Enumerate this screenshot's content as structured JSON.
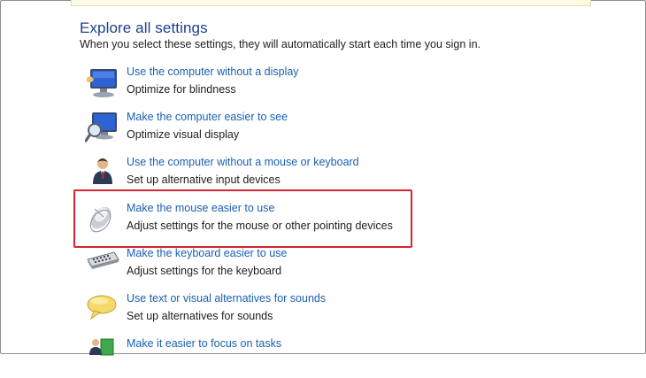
{
  "section": {
    "heading": "Explore all settings",
    "subtitle": "When you select these settings, they will automatically start each time you sign in."
  },
  "items": [
    {
      "icon": "monitor-icon",
      "link": "Use the computer without a display",
      "desc": "Optimize for blindness"
    },
    {
      "icon": "magnifier-monitor-icon",
      "link": "Make the computer easier to see",
      "desc": "Optimize visual display"
    },
    {
      "icon": "person-icon",
      "link": "Use the computer without a mouse or keyboard",
      "desc": "Set up alternative input devices"
    },
    {
      "icon": "mouse-icon",
      "link": "Make the mouse easier to use",
      "desc": "Adjust settings for the mouse or other pointing devices"
    },
    {
      "icon": "keyboard-icon",
      "link": "Make the keyboard easier to use",
      "desc": "Adjust settings for the keyboard"
    },
    {
      "icon": "speech-bubble-icon",
      "link": "Use text or visual alternatives for sounds",
      "desc": "Set up alternatives for sounds"
    },
    {
      "icon": "task-person-icon",
      "link": "Make it easier to focus on tasks",
      "desc": ""
    }
  ],
  "colors": {
    "heading": "#1b3f8f",
    "link": "#1a5fb4",
    "highlight": "#d6262f"
  }
}
